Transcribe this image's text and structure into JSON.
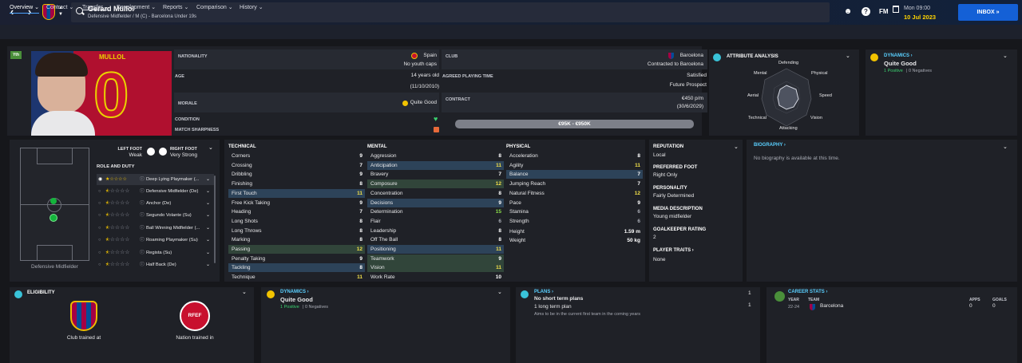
{
  "header": {
    "player_name": "Gerard Mullol",
    "subtitle": "Defensive Midfielder / M (C) - Barcelona Under 19s",
    "fm_label": "FM",
    "day_time": "Mon 09:00",
    "date": "10 Jul 2023",
    "inbox_label": "INBOX"
  },
  "tabs": [
    {
      "label": "Overview"
    },
    {
      "label": "Contract"
    },
    {
      "label": "Transfer"
    },
    {
      "label": "Development"
    },
    {
      "label": "Reports"
    },
    {
      "label": "Comparison"
    },
    {
      "label": "History"
    }
  ],
  "profile": {
    "age_badge": "Yth",
    "shirt_name": "MULLOL",
    "shirt_number": "0",
    "nationality_label": "NATIONALITY",
    "nationality": "Spain",
    "youth_caps": "No youth caps",
    "club_label": "CLUB",
    "club": "Barcelona",
    "club_status": "Contracted to Barcelona",
    "age_label": "AGE",
    "age": "14 years old",
    "dob": "(11/10/2010)",
    "apt_label": "AGREED PLAYING TIME",
    "apt": "Satisfied",
    "apt_sub": "Future Prospect",
    "morale_label": "MORALE",
    "morale": "Quite Good",
    "contract_label": "CONTRACT",
    "wage": "€450 p/m",
    "expiry": "(30/6/2029)",
    "condition_label": "CONDITION",
    "sharpness_label": "MATCH SHARPNESS",
    "value_range": "€95K - €950K"
  },
  "attr_analysis": {
    "title": "ATTRIBUTE ANALYSIS",
    "labels": [
      "Defending",
      "Physical",
      "Speed",
      "Vision",
      "Attacking",
      "Technical",
      "Aerial",
      "Mental"
    ]
  },
  "dynamics_top": {
    "title": "DYNAMICS",
    "value": "Quite Good",
    "positive": "1 Positive",
    "negatives": "0 Negatives"
  },
  "feet": {
    "left_label": "LEFT FOOT",
    "left": "Weak",
    "right_label": "RIGHT FOOT",
    "right": "Very Strong"
  },
  "roles": {
    "title": "ROLE AND DUTY",
    "position": "Defensive Midfielder",
    "items": [
      {
        "label": "Deep Lying Playmaker (..."
      },
      {
        "label": "Defensive Midfielder (De)"
      },
      {
        "label": "Anchor (De)"
      },
      {
        "label": "Segundo Volante (Su)"
      },
      {
        "label": "Ball Winning Midfielder (..."
      },
      {
        "label": "Roaming Playmaker (Su)"
      },
      {
        "label": "Regista (Su)"
      },
      {
        "label": "Half Back (De)"
      }
    ]
  },
  "technical": {
    "title": "TECHNICAL",
    "items": [
      {
        "name": "Corners",
        "value": "9"
      },
      {
        "name": "Crossing",
        "value": "7"
      },
      {
        "name": "Dribbling",
        "value": "9"
      },
      {
        "name": "Finishing",
        "value": "8"
      },
      {
        "name": "First Touch",
        "value": "11"
      },
      {
        "name": "Free Kick Taking",
        "value": "9"
      },
      {
        "name": "Heading",
        "value": "7"
      },
      {
        "name": "Long Shots",
        "value": "8"
      },
      {
        "name": "Long Throws",
        "value": "8"
      },
      {
        "name": "Marking",
        "value": "8"
      },
      {
        "name": "Passing",
        "value": "12"
      },
      {
        "name": "Penalty Taking",
        "value": "9"
      },
      {
        "name": "Tackling",
        "value": "8"
      },
      {
        "name": "Technique",
        "value": "11"
      }
    ]
  },
  "mental": {
    "title": "MENTAL",
    "items": [
      {
        "name": "Aggression",
        "value": "8"
      },
      {
        "name": "Anticipation",
        "value": "11"
      },
      {
        "name": "Bravery",
        "value": "7"
      },
      {
        "name": "Composure",
        "value": "12"
      },
      {
        "name": "Concentration",
        "value": "8"
      },
      {
        "name": "Decisions",
        "value": "9"
      },
      {
        "name": "Determination",
        "value": "15"
      },
      {
        "name": "Flair",
        "value": "6"
      },
      {
        "name": "Leadership",
        "value": "8"
      },
      {
        "name": "Off The Ball",
        "value": "8"
      },
      {
        "name": "Positioning",
        "value": "11"
      },
      {
        "name": "Teamwork",
        "value": "9"
      },
      {
        "name": "Vision",
        "value": "11"
      },
      {
        "name": "Work Rate",
        "value": "10"
      }
    ]
  },
  "physical": {
    "title": "PHYSICAL",
    "items": [
      {
        "name": "Acceleration",
        "value": "8"
      },
      {
        "name": "Agility",
        "value": "11"
      },
      {
        "name": "Balance",
        "value": "7"
      },
      {
        "name": "Jumping Reach",
        "value": "7"
      },
      {
        "name": "Natural Fitness",
        "value": "12"
      },
      {
        "name": "Pace",
        "value": "9"
      },
      {
        "name": "Stamina",
        "value": "6"
      },
      {
        "name": "Strength",
        "value": "6"
      }
    ],
    "height_label": "Height",
    "height": "1.59 m",
    "weight_label": "Weight",
    "weight": "50 kg"
  },
  "info": {
    "reputation_label": "REPUTATION",
    "reputation": "Local",
    "foot_label": "PREFERRED FOOT",
    "foot": "Right Only",
    "personality_label": "PERSONALITY",
    "personality": "Fairly Determined",
    "media_label": "MEDIA DESCRIPTION",
    "media": "Young midfielder",
    "gk_label": "GOALKEEPER RATING",
    "gk": "2",
    "traits_label": "PLAYER TRAITS",
    "traits": "None"
  },
  "biography": {
    "title": "BIOGRAPHY",
    "text": "No biography is available at this time."
  },
  "eligibility": {
    "title": "ELIGIBILITY",
    "club_trained": "Club trained at",
    "nation_trained": "Nation trained in",
    "rfef": "RFEF"
  },
  "dynamics_bottom": {
    "title": "DYNAMICS",
    "value": "Quite Good",
    "positive": "1 Positive",
    "negatives": "0 Negatives"
  },
  "plans": {
    "title": "PLANS",
    "short": "No short term plans",
    "long": "1 long term plan",
    "note": "Aims to be in the current first team in the coming years",
    "short_count": "1",
    "long_count": "1"
  },
  "career": {
    "title": "CAREER STATS",
    "year_h": "YEAR",
    "team_h": "TEAM",
    "apps_h": "APPS",
    "goals_h": "GOALS",
    "year": "22-24",
    "team": "Barcelona",
    "apps": "0",
    "goals": "0"
  }
}
